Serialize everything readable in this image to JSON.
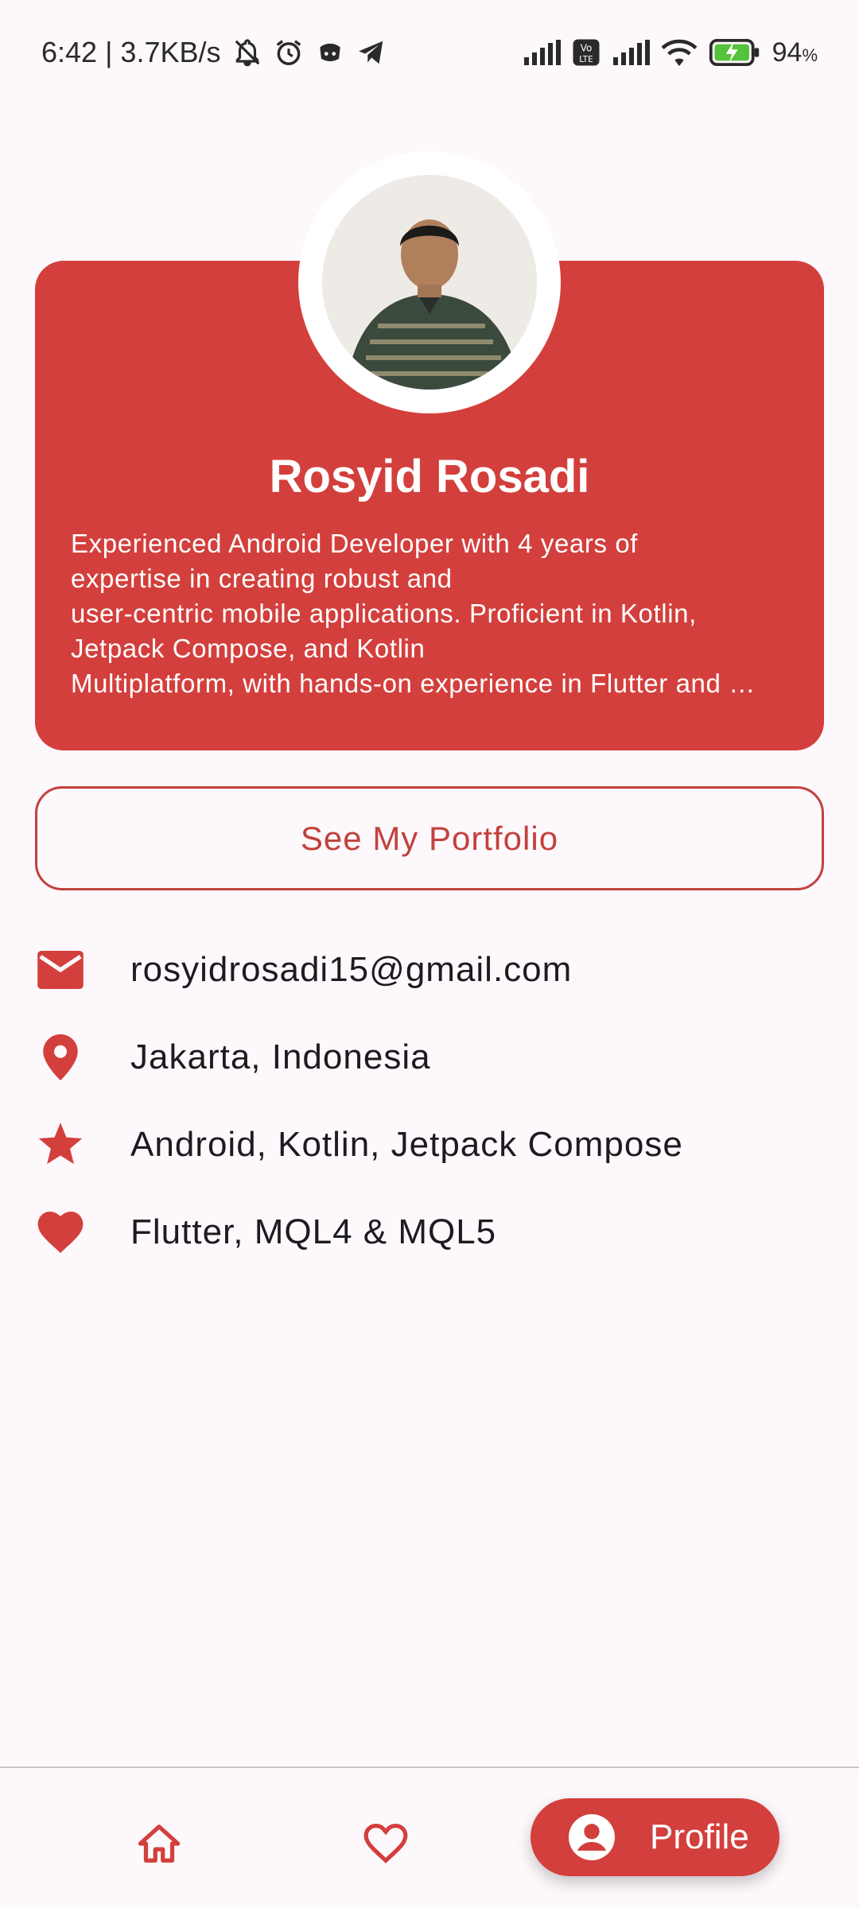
{
  "status_bar": {
    "time_speed": "6:42 | 3.7KB/s",
    "battery": "94",
    "battery_unit": "%",
    "icons": [
      "mute-bell-icon",
      "alarm-icon",
      "discord-icon",
      "telegram-icon",
      "signal-icon",
      "volte-icon",
      "signal-icon",
      "wifi-icon",
      "battery-charging-icon"
    ]
  },
  "profile": {
    "name": "Rosyid Rosadi",
    "bio_lines": [
      "Experienced Android Developer with 4 years of",
      "expertise in creating robust and",
      "user-centric mobile applications. Proficient in Kotlin,",
      "Jetpack Compose, and Kotlin",
      "Multiplatform, with hands-on experience in Flutter and …"
    ]
  },
  "portfolio_button": {
    "label": "See My Portfolio"
  },
  "info": [
    {
      "icon": "email-icon",
      "text": "rosyidrosadi15@gmail.com"
    },
    {
      "icon": "location-pin-icon",
      "text": "Jakarta, Indonesia"
    },
    {
      "icon": "star-icon",
      "text": "Android, Kotlin, Jetpack Compose"
    },
    {
      "icon": "heart-icon",
      "text": "Flutter, MQL4 & MQL5"
    }
  ],
  "bottom_nav": {
    "items": [
      {
        "icon": "home-icon",
        "label": ""
      },
      {
        "icon": "heart-outline-icon",
        "label": ""
      },
      {
        "icon": "account-circle-icon",
        "label": "Profile",
        "selected": true
      }
    ]
  },
  "colors": {
    "accent": "#d33f3c",
    "background": "#fdf8fb",
    "text": "#1d1b20"
  }
}
